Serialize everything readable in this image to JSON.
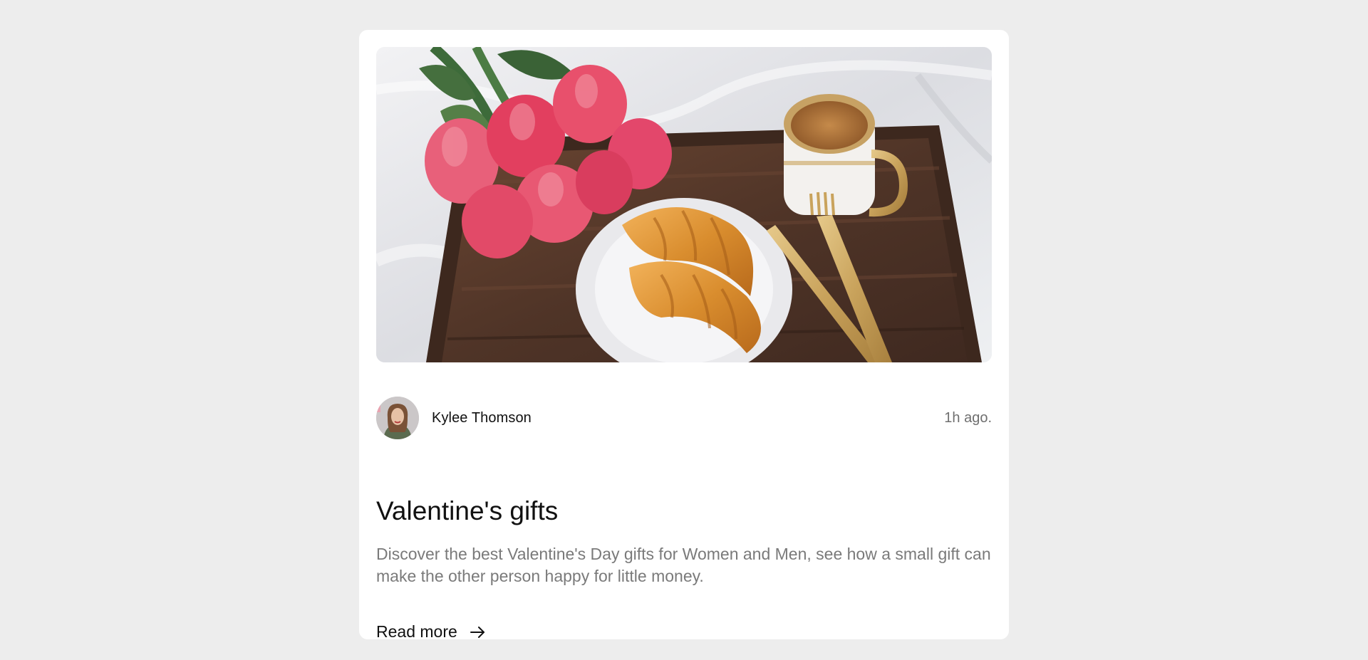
{
  "card": {
    "author": {
      "name": "Kylee Thomson",
      "time": "1h ago."
    },
    "title": "Valentine's gifts",
    "description": "Discover the best Valentine's Day gifts for Women and Men, see how a small gift can make the other person happy for little money.",
    "read_more_label": "Read more",
    "icons": {
      "avatar": "avatar-photo",
      "arrow": "arrow-right-icon",
      "hero": "breakfast-tray-photo"
    }
  }
}
